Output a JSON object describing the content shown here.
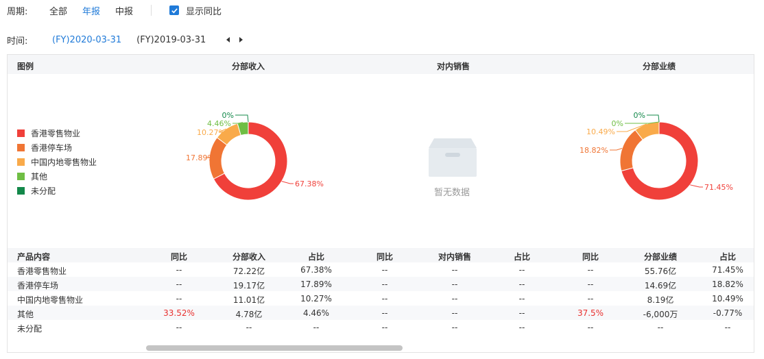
{
  "period": {
    "label": "周期:",
    "tabs": [
      "全部",
      "年报",
      "中报"
    ],
    "active_tab": "年报",
    "show_yoy_label": "显示同比",
    "show_yoy_checked": true
  },
  "time": {
    "label": "时间:",
    "dates": [
      "(FY)2020-03-31",
      "(FY)2019-03-31"
    ],
    "active_date": "(FY)2020-03-31"
  },
  "section_headers": {
    "legend": "图例",
    "revenue": "分部收入",
    "internal_sales": "对内销售",
    "performance": "分部业绩"
  },
  "legend": [
    {
      "label": "香港零售物业",
      "color": "#f0403a"
    },
    {
      "label": "香港停车场",
      "color": "#f07534"
    },
    {
      "label": "中国内地零售物业",
      "color": "#f9aa4a"
    },
    {
      "label": "其他",
      "color": "#6fbe44"
    },
    {
      "label": "未分配",
      "color": "#13884a"
    }
  ],
  "chart_data": [
    {
      "type": "pie",
      "title": "分部收入",
      "categories": [
        "香港零售物业",
        "香港停车场",
        "中国内地零售物业",
        "其他",
        "未分配"
      ],
      "values": [
        67.38,
        17.89,
        10.27,
        4.46,
        0
      ],
      "labels": [
        "67.38%",
        "17.89%",
        "10.27%",
        "4.46%",
        "0%"
      ]
    },
    {
      "type": "pie",
      "title": "分部业绩",
      "categories": [
        "香港零售物业",
        "香港停车场",
        "中国内地零售物业",
        "其他",
        "未分配"
      ],
      "values": [
        71.45,
        18.82,
        10.49,
        0,
        0
      ],
      "labels": [
        "71.45%",
        "18.82%",
        "10.49%",
        "0%",
        "0%"
      ]
    }
  ],
  "empty_state": {
    "text": "暂无数据",
    "icon": "empty-box-icon"
  },
  "table": {
    "headers": [
      "产品内容",
      "同比",
      "分部收入",
      "占比",
      "同比",
      "对内销售",
      "占比",
      "同比",
      "分部业绩",
      "占比"
    ],
    "rows": [
      [
        "香港零售物业",
        "--",
        "72.22亿",
        "67.38%",
        "--",
        "--",
        "--",
        "--",
        "55.76亿",
        "71.45%"
      ],
      [
        "香港停车场",
        "--",
        "19.17亿",
        "17.89%",
        "--",
        "--",
        "--",
        "--",
        "14.69亿",
        "18.82%"
      ],
      [
        "中国内地零售物业",
        "--",
        "11.01亿",
        "10.27%",
        "--",
        "--",
        "--",
        "--",
        "8.19亿",
        "10.49%"
      ],
      [
        "其他",
        "33.52%",
        "4.78亿",
        "4.46%",
        "--",
        "--",
        "--",
        "37.5%",
        "-6,000万",
        "-0.77%"
      ],
      [
        "未分配",
        "--",
        "--",
        "--",
        "--",
        "--",
        "--",
        "--",
        "--",
        "--"
      ]
    ],
    "highlight_color": "#e8312f"
  },
  "colors": {
    "accent": "#1f7ad8",
    "header_bg": "#f5f6f8"
  }
}
